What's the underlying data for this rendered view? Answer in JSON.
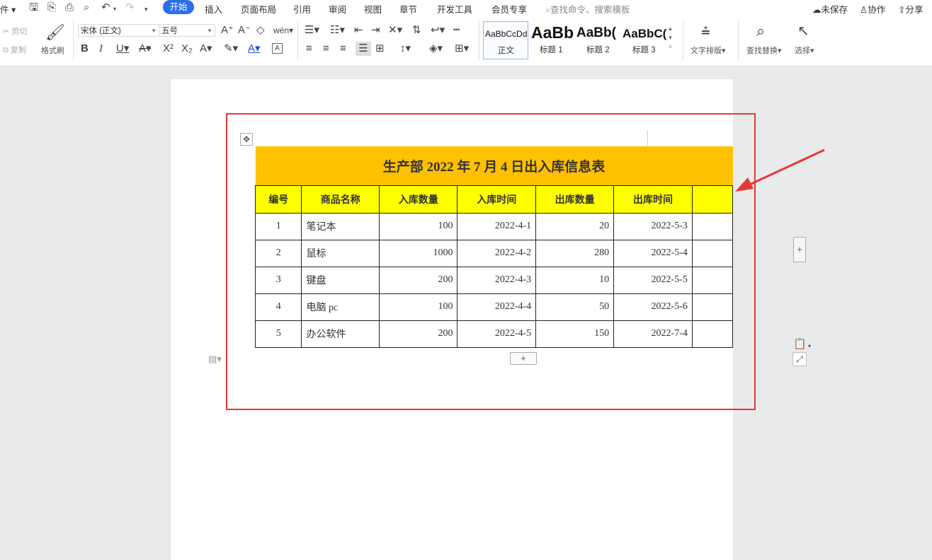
{
  "menubar": {
    "file_partial": "件",
    "tabs": [
      "开始",
      "插入",
      "页面布局",
      "引用",
      "审阅",
      "视图",
      "章节",
      "开发工具",
      "会员专享"
    ],
    "active_tab": "开始",
    "search_placeholder": "查找命令、搜索模板",
    "right": {
      "unsaved": "未保存",
      "collab": "协作",
      "share": "分享"
    }
  },
  "ribbon": {
    "cut": "剪切",
    "copy": "复制",
    "format_painter": "格式刷",
    "font_name": "宋体 (正文)",
    "font_size": "五号",
    "styles": [
      {
        "sample": "AaBbCcDd",
        "label": "正文"
      },
      {
        "sample": "AaBb",
        "label": "标题 1"
      },
      {
        "sample": "AaBb(",
        "label": "标题 2"
      },
      {
        "sample": "AaBbC(",
        "label": "标题 3"
      }
    ],
    "text_layout": "文字排版",
    "find_replace": "查找替换",
    "select": "选择"
  },
  "document": {
    "table_title": "生产部 2022 年 7 月 4 日出入库信息表",
    "headers": [
      "编号",
      "商品名称",
      "入库数量",
      "入库时间",
      "出库数量",
      "出库时间",
      ""
    ],
    "rows": [
      [
        "1",
        "笔记本",
        "100",
        "2022-4-1",
        "20",
        "2022-5-3",
        ""
      ],
      [
        "2",
        "鼠标",
        "1000",
        "2022-4-2",
        "280",
        "2022-5-4",
        ""
      ],
      [
        "3",
        "键盘",
        "200",
        "2022-4-3",
        "10",
        "2022-5-5",
        ""
      ],
      [
        "4",
        "电脑 pc",
        "100",
        "2022-4-4",
        "50",
        "2022-5-6",
        ""
      ],
      [
        "5",
        "办公软件",
        "200",
        "2022-4-5",
        "150",
        "2022-7-4",
        ""
      ]
    ]
  },
  "colors": {
    "accent": "#2b6ee8",
    "title_fill": "#ffc000",
    "header_fill": "#ffff00",
    "highlight_box": "#e53935"
  }
}
